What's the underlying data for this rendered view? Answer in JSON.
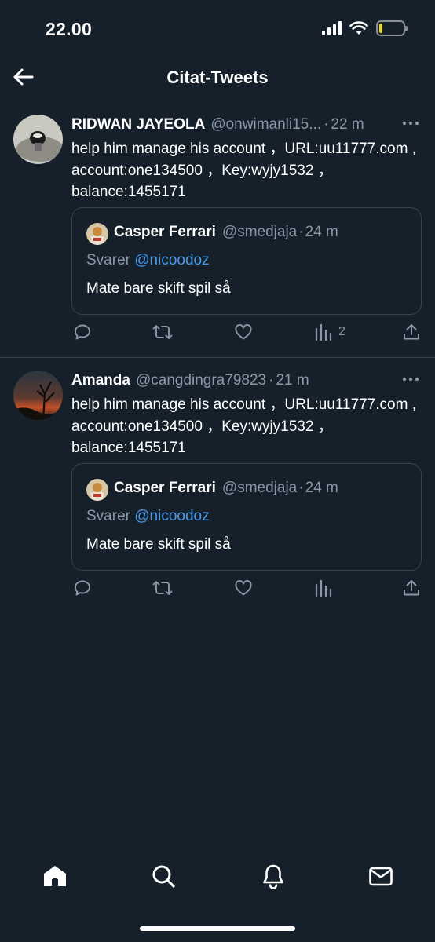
{
  "status_bar": {
    "time": "22.00",
    "battery_level_fraction": 0.15,
    "battery_color": "#f2d52a"
  },
  "header": {
    "title": "Citat-Tweets",
    "back_icon": "arrow-left-icon"
  },
  "tweets": [
    {
      "name": "RIDWAN JAYEOLA",
      "handle": "@onwimanli15...",
      "dot": "·",
      "time": "22 m",
      "body": "help him manage his account ，URL:uu11777.com , account:one134500 ，Key:wyjy1532 ，balance:1455171",
      "quote": {
        "name": "Casper Ferrari",
        "handle": "@smedjaja",
        "dot": "·",
        "time": "24 m",
        "reply_prefix": "Svarer",
        "reply_mention": "@nicoodoz",
        "text": "Mate bare skift spil så"
      },
      "views_count": "2"
    },
    {
      "name": "Amanda",
      "handle": "@cangdingra79823",
      "dot": "·",
      "time": "21 m",
      "body": "help him manage his account ，URL:uu11777.com , account:one134500 ，Key:wyjy1532 ，balance:1455171",
      "quote": {
        "name": "Casper Ferrari",
        "handle": "@smedjaja",
        "dot": "·",
        "time": "24 m",
        "reply_prefix": "Svarer",
        "reply_mention": "@nicoodoz",
        "text": "Mate bare skift spil så"
      },
      "views_count": ""
    }
  ],
  "tab_bar": {
    "items": [
      "home-icon",
      "search-icon",
      "notifications-bell-icon",
      "messages-envelope-icon"
    ],
    "active": "home-icon"
  },
  "colors": {
    "background": "#15202b",
    "divider": "#38444d",
    "secondary_text": "#8b98a5",
    "link": "#4a99e9"
  }
}
